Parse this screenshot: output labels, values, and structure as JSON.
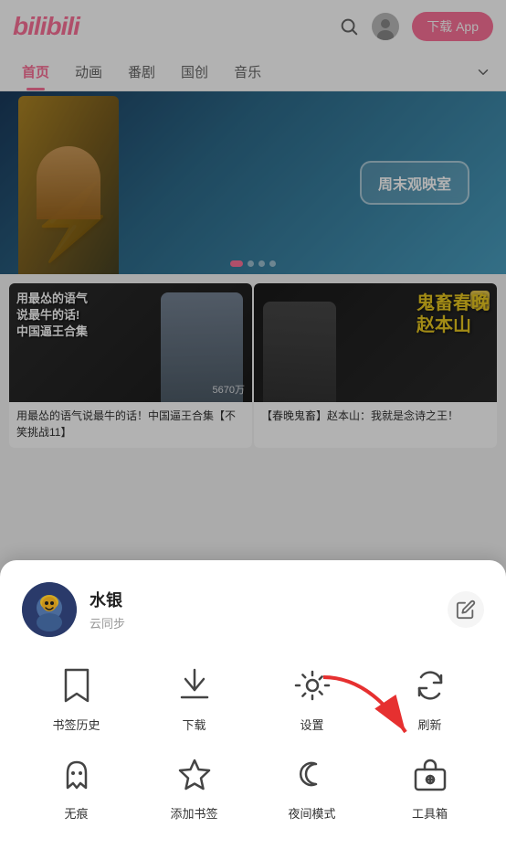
{
  "header": {
    "logo": "bilibili",
    "download_label": "下载 App",
    "search_placeholder": "搜索"
  },
  "nav": {
    "tabs": [
      "首页",
      "动画",
      "番剧",
      "国创",
      "音乐"
    ],
    "active_tab": "首页"
  },
  "banner": {
    "box_text": "周末观映室",
    "dots": 4,
    "active_dot": 0
  },
  "videos": [
    {
      "title": "用最怂的语气说最牛的话！中国逼王合集【不笑挑战11】",
      "overlay_text": "用最怂的语气\n说最牛的话!\n中国逼王合集",
      "views": "5670万"
    },
    {
      "title": "【春晚鬼畜】赵本山：我就是念诗之王！",
      "badge": "可",
      "yellow_text": "鬼畜春晚\n赵本山"
    }
  ],
  "sheet": {
    "user": {
      "name": "水银",
      "sync_label": "云同步",
      "avatar_emoji": "🦁"
    },
    "menu_row1": [
      {
        "id": "bookmark",
        "label": "书签历史"
      },
      {
        "id": "download",
        "label": "下载"
      },
      {
        "id": "settings",
        "label": "设置"
      },
      {
        "id": "refresh",
        "label": "刷新"
      }
    ],
    "menu_row2": [
      {
        "id": "ghost",
        "label": "无痕"
      },
      {
        "id": "star",
        "label": "添加书签"
      },
      {
        "id": "night",
        "label": "夜间模式"
      },
      {
        "id": "toolbox",
        "label": "工具箱"
      }
    ]
  }
}
